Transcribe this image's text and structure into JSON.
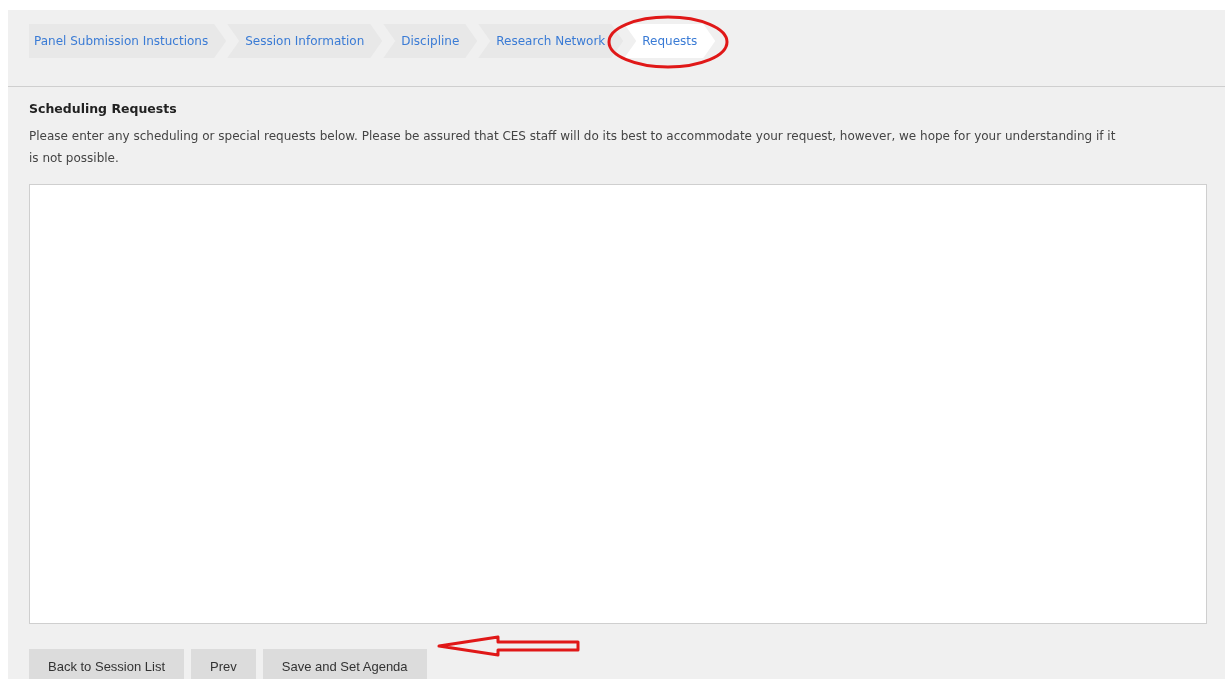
{
  "steps": [
    {
      "label": "Panel Submission Instuctions",
      "selected": false
    },
    {
      "label": "Session Information",
      "selected": false
    },
    {
      "label": "Discipline",
      "selected": false
    },
    {
      "label": "Research Network",
      "selected": false
    },
    {
      "label": "Requests",
      "selected": true
    }
  ],
  "section": {
    "title": "Scheduling Requests",
    "description": "Please enter any scheduling or special requests below. Please be assured that CES staff will do its best to accommodate your request, however, we hope for your understanding if it is not possible."
  },
  "buttons": [
    "Back to Session List",
    "Prev",
    "Save and Set Agenda"
  ]
}
